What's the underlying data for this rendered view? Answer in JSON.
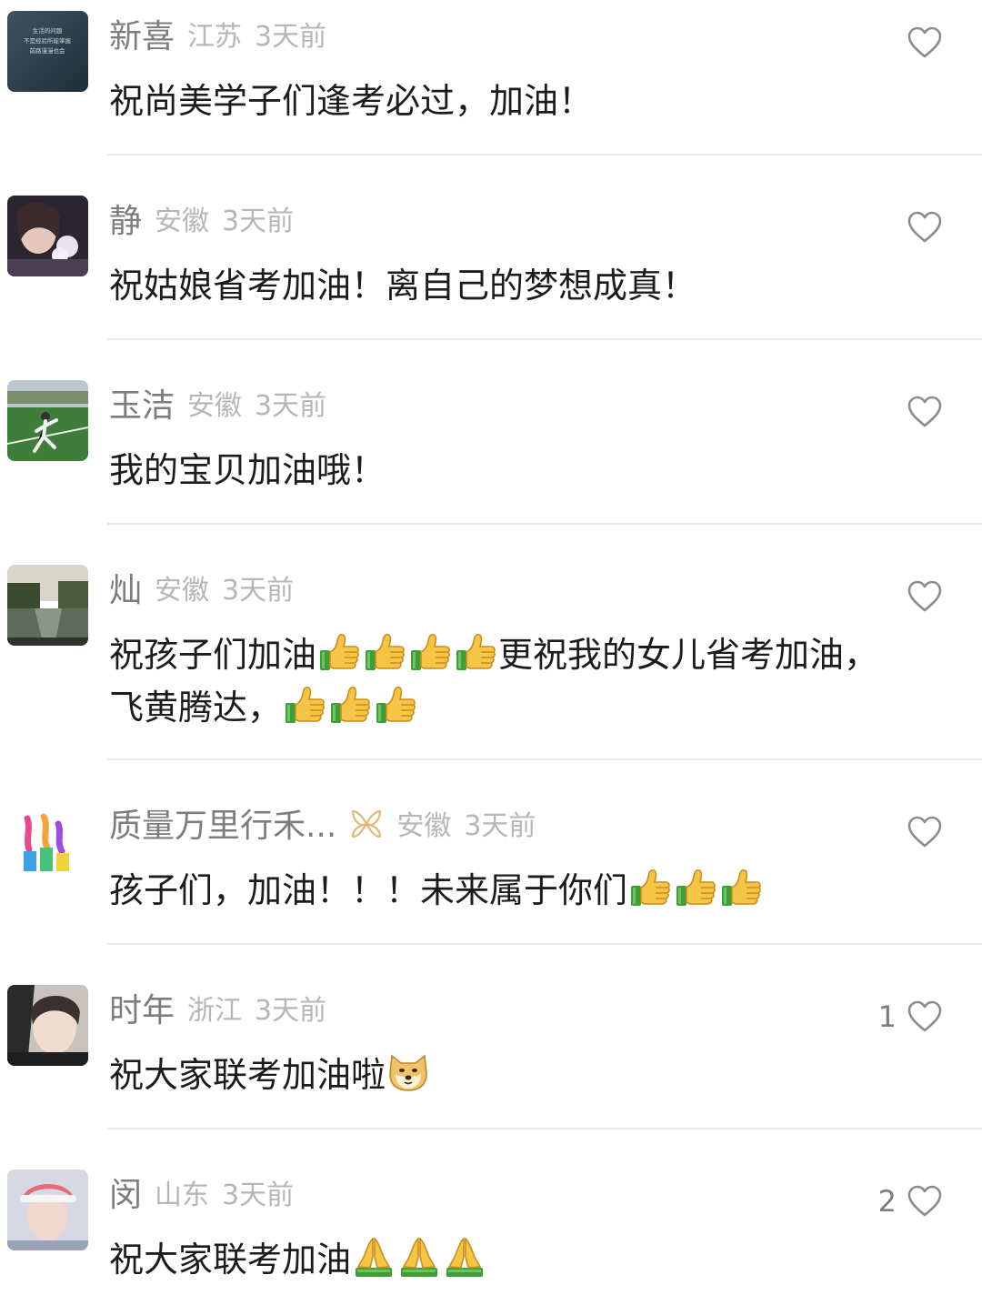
{
  "comments": [
    {
      "username": "新喜",
      "location": "江苏",
      "time": "3天前",
      "text_parts": [
        "祝尚美学子们逢考必过，加油！"
      ],
      "likes": "",
      "avatar_text": [
        "生活的问题",
        "不是经验所能掌握",
        "前路漫漫也会"
      ]
    },
    {
      "username": "静",
      "location": "安徽",
      "time": "3天前",
      "text_parts": [
        "祝姑娘省考加油！离自己的梦想成真！"
      ],
      "likes": ""
    },
    {
      "username": "玉洁",
      "location": "安徽",
      "time": "3天前",
      "text_parts": [
        "我的宝贝加油哦！"
      ],
      "likes": ""
    },
    {
      "username": "灿",
      "location": "安徽",
      "time": "3天前",
      "text_parts": [
        "祝孩子们加油",
        "更祝我的女儿省考加油，",
        "飞黄腾达，"
      ],
      "likes": ""
    },
    {
      "username": "质量万里行禾...",
      "location": "安徽",
      "time": "3天前",
      "text_parts": [
        "孩子们，加油！！！未来属于你们"
      ],
      "likes": ""
    },
    {
      "username": "时年",
      "location": "浙江",
      "time": "3天前",
      "text_parts": [
        "祝大家联考加油啦"
      ],
      "likes": "1"
    },
    {
      "username": "闵",
      "location": "山东",
      "time": "3天前",
      "text_parts": [
        "祝大家联考加油"
      ],
      "likes": "2"
    }
  ],
  "icons": {
    "like": "heart-outline-icon",
    "thumbs_up": "thumbs-up-emoji",
    "doge": "doge-emoji",
    "pray": "pray-emoji",
    "badge": "ribbon-badge-icon"
  },
  "colors": {
    "username": "#7d7d7d",
    "meta": "#b6b6b6",
    "text": "#1c1c1c",
    "divider": "#e8e8e8"
  }
}
